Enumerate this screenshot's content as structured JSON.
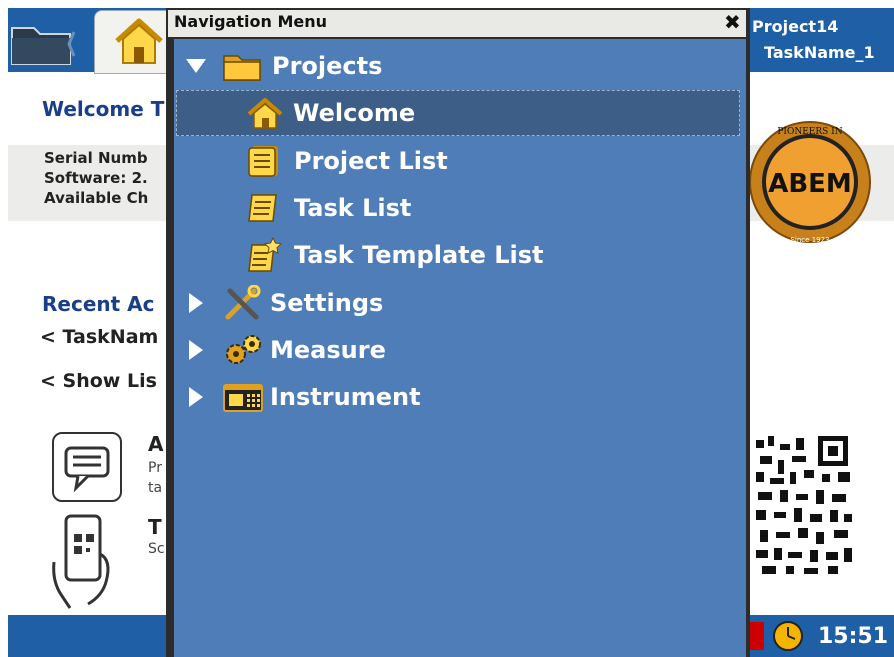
{
  "header": {
    "project": "Project14",
    "task": "TaskName_1"
  },
  "background_page": {
    "welcome_title": "Welcome T",
    "info_lines": [
      "Serial Numb",
      "Software: 2.",
      "Available Ch"
    ],
    "recent_title": "Recent Ac",
    "recent_items": [
      "< TaskNam",
      "< Show Lis"
    ],
    "app_entries": [
      {
        "title": "A",
        "lines": [
          "Pr",
          "ta"
        ]
      },
      {
        "title": "T",
        "lines": [
          "Sc"
        ]
      }
    ]
  },
  "logo": {
    "name": "ABEM",
    "ring_text": "PIONEERS IN GEOPHYSICS",
    "since": "Since 1923"
  },
  "status": {
    "time": "15:51"
  },
  "nav_menu": {
    "title": "Navigation Menu",
    "close_glyph": "✖",
    "items": [
      {
        "label": "Projects",
        "icon": "folder-icon",
        "expanded": true
      },
      {
        "label": "Welcome",
        "icon": "home-icon",
        "selected": true
      },
      {
        "label": "Project List",
        "icon": "list-icon"
      },
      {
        "label": "Task List",
        "icon": "task-icon"
      },
      {
        "label": "Task Template List",
        "icon": "template-icon"
      },
      {
        "label": "Settings",
        "icon": "tools-icon",
        "expanded": false
      },
      {
        "label": "Measure",
        "icon": "gears-icon",
        "expanded": false
      },
      {
        "label": "Instrument",
        "icon": "instrument-icon",
        "expanded": false
      }
    ]
  },
  "colors": {
    "primary_blue": "#1f5fa6",
    "menu_blue": "#4f7db8",
    "selected_row": "#3d5e86"
  }
}
